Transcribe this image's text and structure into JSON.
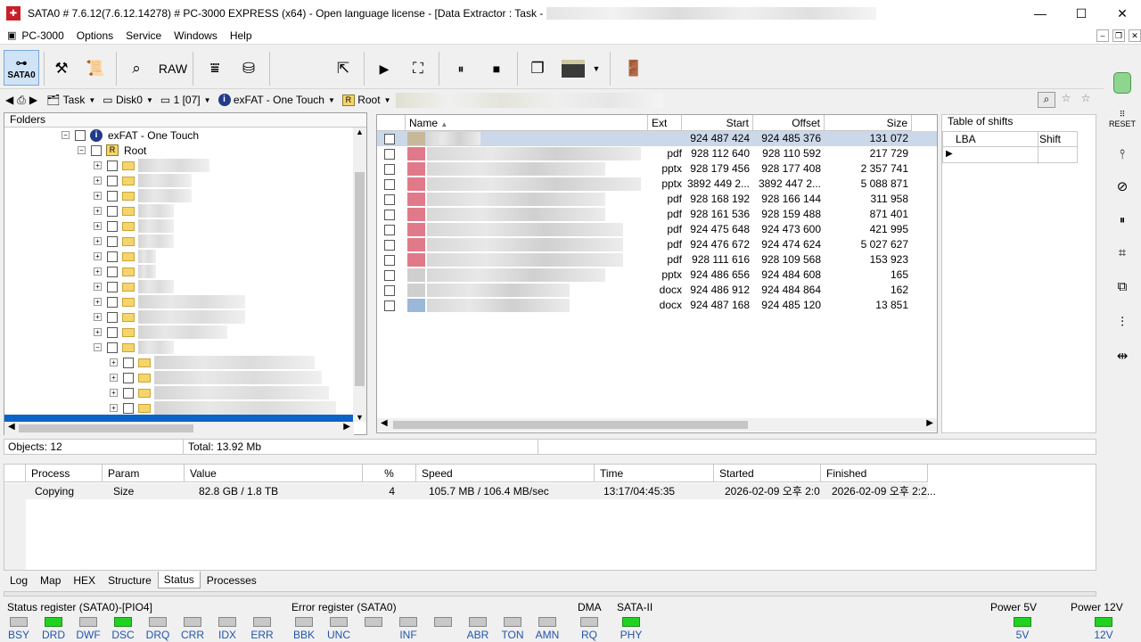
{
  "window": {
    "title": "SATA0 # 7.6.12(7.6.12.14278) # PC-3000 EXPRESS (x64) - Open language license - [Data Extractor : Task -"
  },
  "menu": {
    "app": "PC-3000",
    "items": [
      "Options",
      "Service",
      "Windows",
      "Help"
    ]
  },
  "toolbar": {
    "sata0": "SATA0",
    "raw": "RAW"
  },
  "nav": {
    "task": "Task",
    "disk": "Disk0",
    "part": "1 [07]",
    "volume": "exFAT - One Touch",
    "root": "Root"
  },
  "folders": {
    "header": "Folders",
    "volume": "exFAT - One Touch",
    "root": "Root"
  },
  "files": {
    "columns": {
      "name": "Name",
      "ext": "Ext",
      "start": "Start",
      "offset": "Offset",
      "size": "Size"
    },
    "rows": [
      {
        "ext": "",
        "start": "924 487 424",
        "offset": "924 485 376",
        "size": "131 072"
      },
      {
        "ext": "pdf",
        "start": "928 112 640",
        "offset": "928 110 592",
        "size": "217 729"
      },
      {
        "ext": "pptx",
        "start": "928 179 456",
        "offset": "928 177 408",
        "size": "2 357 741"
      },
      {
        "ext": "pptx",
        "start": "3892 449 2...",
        "offset": "3892 447 2...",
        "size": "5 088 871"
      },
      {
        "ext": "pdf",
        "start": "928 168 192",
        "offset": "928 166 144",
        "size": "311 958"
      },
      {
        "ext": "pdf",
        "start": "928 161 536",
        "offset": "928 159 488",
        "size": "871 401"
      },
      {
        "ext": "pdf",
        "start": "924 475 648",
        "offset": "924 473 600",
        "size": "421 995"
      },
      {
        "ext": "pdf",
        "start": "924 476 672",
        "offset": "924 474 624",
        "size": "5 027 627"
      },
      {
        "ext": "pdf",
        "start": "928 111 616",
        "offset": "928 109 568",
        "size": "153 923"
      },
      {
        "ext": "pptx",
        "start": "924 486 656",
        "offset": "924 484 608",
        "size": "165"
      },
      {
        "ext": "docx",
        "start": "924 486 912",
        "offset": "924 484 864",
        "size": "162"
      },
      {
        "ext": "docx",
        "start": "924 487 168",
        "offset": "924 485 120",
        "size": "13 851"
      }
    ]
  },
  "shifts": {
    "title": "Table of shifts",
    "col_lba": "LBA",
    "col_shift": "Shift"
  },
  "status": {
    "objects": "Objects: 12",
    "total": "Total: 13.92 Mb"
  },
  "process": {
    "headers": {
      "process": "Process",
      "param": "Param",
      "value": "Value",
      "percent": "%",
      "speed": "Speed",
      "time": "Time",
      "started": "Started",
      "finished": "Finished"
    },
    "row": {
      "process": "Copying",
      "param": "Size",
      "value": "82.8 GB / 1.8 TB",
      "percent": "4",
      "speed": "105.7 MB / 106.4 MB/sec",
      "time": "13:17/04:45:35",
      "started": "2026-02-09 오후 2:0...",
      "finished": "2026-02-09 오후 2:2..."
    }
  },
  "tabs": [
    "Log",
    "Map",
    "HEX",
    "Structure",
    "Status",
    "Processes"
  ],
  "registers": {
    "status_title": "Status register (SATA0)-[PIO4]",
    "error_title": "Error register (SATA0)",
    "dma": "DMA",
    "sata": "SATA-II",
    "power5": "Power 5V",
    "power12": "Power 12V",
    "status_bits": [
      "BSY",
      "DRD",
      "DWF",
      "DSC",
      "DRQ",
      "CRR",
      "IDX",
      "ERR"
    ],
    "error_bits": [
      "BBK",
      "UNC",
      "",
      "INF",
      "",
      "ABR",
      "TON",
      "AMN"
    ],
    "dma_bit": "RQ",
    "sata_bit": "PHY",
    "v5": "5V",
    "v12": "12V"
  },
  "colors": {
    "led_on": "#21d321",
    "selection": "#cbd8ea",
    "tree_selection": "#0a64c8"
  }
}
